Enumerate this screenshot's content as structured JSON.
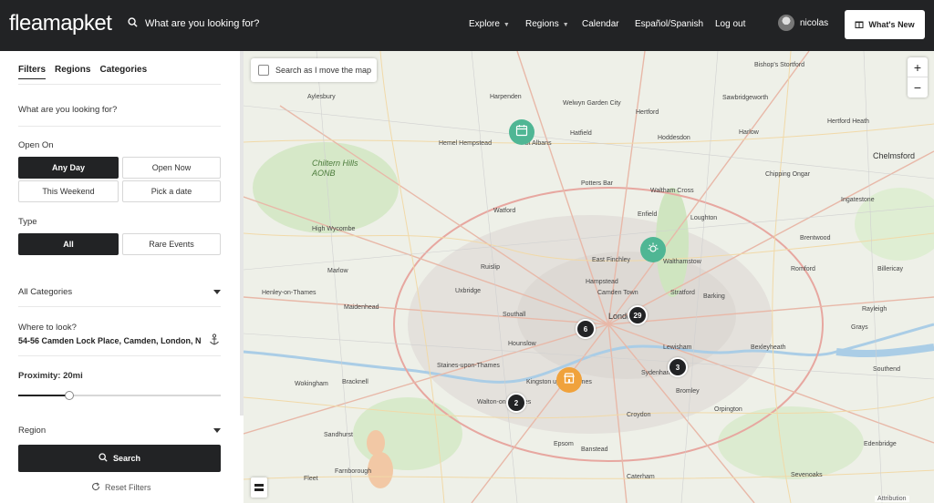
{
  "app": {
    "logo_text": "fleamapket",
    "search_placeholder": "What are you looking for?"
  },
  "nav": {
    "items": [
      {
        "label": "Explore",
        "has_dropdown": true
      },
      {
        "label": "Regions",
        "has_dropdown": true
      },
      {
        "label": "Calendar",
        "has_dropdown": false
      },
      {
        "label": "Español/Spanish",
        "has_dropdown": false
      },
      {
        "label": "Log out",
        "has_dropdown": false
      }
    ],
    "user_name": "nicolas",
    "whats_new_label": "What's New"
  },
  "sidebar": {
    "tabs": [
      "Filters",
      "Regions",
      "Categories"
    ],
    "query_label": "What are you looking for?",
    "open_on": {
      "label": "Open On",
      "options": [
        "Any Day",
        "Open Now",
        "This Weekend",
        "Pick a date"
      ],
      "selected": "Any Day"
    },
    "type": {
      "label": "Type",
      "options": [
        "All",
        "Rare Events"
      ],
      "selected": "All"
    },
    "categories_value": "All Categories",
    "where_label": "Where to look?",
    "where_value": "54-56 Camden Lock Place, Camden, London, N",
    "proximity_label": "Proximity: 20mi",
    "proximity_fraction": 0.25,
    "region_label": "Region",
    "search_button": "Search",
    "reset_label": "Reset Filters"
  },
  "map": {
    "search_as_move_label": "Search as I move the map",
    "zoom_in": "+",
    "zoom_out": "−",
    "attribution": "Attribution",
    "clusters": [
      {
        "count": "29"
      },
      {
        "count": "6"
      },
      {
        "count": "3"
      },
      {
        "count": "2"
      }
    ],
    "labels": {
      "aylesbury": "Aylesbury",
      "harpenden": "Harpenden",
      "welwyn": "Welwyn Garden City",
      "hertford": "Hertford",
      "hemel": "Hemel Hempstead",
      "st_albans": "St Albans",
      "hatfield": "Hatfield",
      "hoddesdon": "Hoddesdon",
      "harlow": "Harlow",
      "chelmsford": "Chelmsford",
      "chiltern": "Chiltern Hills AONB",
      "high_wycombe": "High Wycombe",
      "watford": "Watford",
      "potters_bar": "Potters Bar",
      "waltham_cross": "Waltham Cross",
      "chipping_ongar": "Chipping Ongar",
      "enfield": "Enfield",
      "loughton": "Loughton",
      "brentwood": "Brentwood",
      "marlow": "Marlow",
      "ruislip": "Ruislip",
      "east_finchley": "East Finchley",
      "walthamstow": "Walthamstow",
      "romford": "Romford",
      "billericay": "Billericay",
      "henley": "Henley-on-Thames",
      "maidenhead": "Maidenhead",
      "uxbridge": "Uxbridge",
      "hampstead": "Hampstead",
      "camden_town": "Camden Town",
      "stratford": "Stratford",
      "barking": "Barking",
      "southall": "Southall",
      "london": "London",
      "hounslow": "Hounslow",
      "lewisham": "Lewisham",
      "bexleyheath": "Bexleyheath",
      "staines": "Staines-upon-Thames",
      "kingston": "Kingston upon Thames",
      "sydenham": "Sydenham",
      "bromley": "Bromley",
      "bracknell": "Bracknell",
      "wokingham": "Wokingham",
      "walton": "Walton-on-Thames",
      "croydon": "Croydon",
      "orpington": "Orpington",
      "epsom": "Epsom",
      "banstead": "Banstead",
      "sandhurst": "Sandhurst",
      "fleet": "Fleet",
      "farnborough": "Farnborough",
      "caterham": "Caterham",
      "sevenoaks": "Sevenoaks",
      "east_grinstead": "Edenbridge",
      "grays": "Grays",
      "southend": "Southend",
      "rayleigh": "Rayleigh",
      "bishops": "Bishop's Stortford",
      "sawbridgeworth": "Sawbridgeworth",
      "ingatestone": "Ingatestone",
      "hertford_heath": "Hertford Heath"
    }
  },
  "colors": {
    "header_bg": "#222325",
    "cluster_bg": "#222325",
    "marker_teal": "#4fb694",
    "marker_orange": "#f0a23c"
  }
}
